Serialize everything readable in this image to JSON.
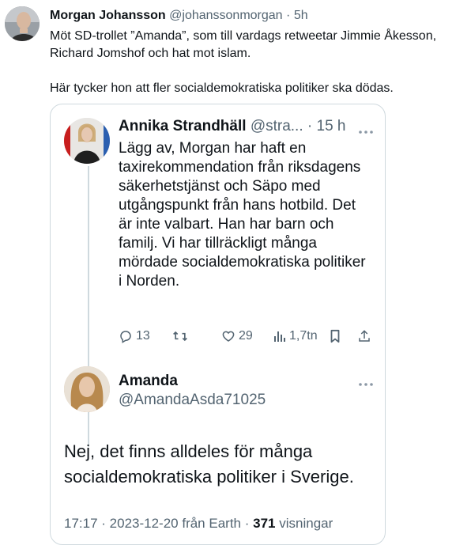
{
  "outer": {
    "author_name": "Morgan Johansson",
    "author_handle": "@johanssonmorgan",
    "separator": "·",
    "time": "5h",
    "text_line1": "Möt SD-trollet ”Amanda”, som till vardags retweetar Jimmie Åkesson, Richard Jomshof och hat mot islam.",
    "text_line2": "Här tycker hon att fler socialdemokratiska politiker ska dödas."
  },
  "quoted": {
    "author_name": "Annika Strandhäll",
    "author_handle": "@stra...",
    "separator": "·",
    "time": "15 h",
    "text": "Lägg av, Morgan har haft en taxirekommendation från riksdagens säkerhetstjänst och Säpo med utgångspunkt från hans hotbild. Det är inte valbart. Han har barn och familj. Vi har tillräckligt många mördade socialdemokratiska politiker i Norden.",
    "replies": "13",
    "likes": "29",
    "views": "1,7tn"
  },
  "reply": {
    "author_name": "Amanda",
    "author_handle": "@AmandaAsda71025",
    "text": "Nej, det finns alldeles för många socialdemokratiska politiker i Sverige.",
    "time": "17:17",
    "date_source": "· 2023-12-20 från Earth ·",
    "views_count": "371",
    "views_label": "visningar"
  },
  "icons": {
    "more": "more-horizontal-icon",
    "reply": "reply-icon",
    "retweet": "retweet-icon",
    "like": "heart-icon",
    "views": "views-icon",
    "bookmark": "bookmark-icon",
    "share": "share-icon"
  },
  "colors": {
    "text": "#0f1419",
    "muted": "#536471",
    "border": "#cfd9de"
  }
}
